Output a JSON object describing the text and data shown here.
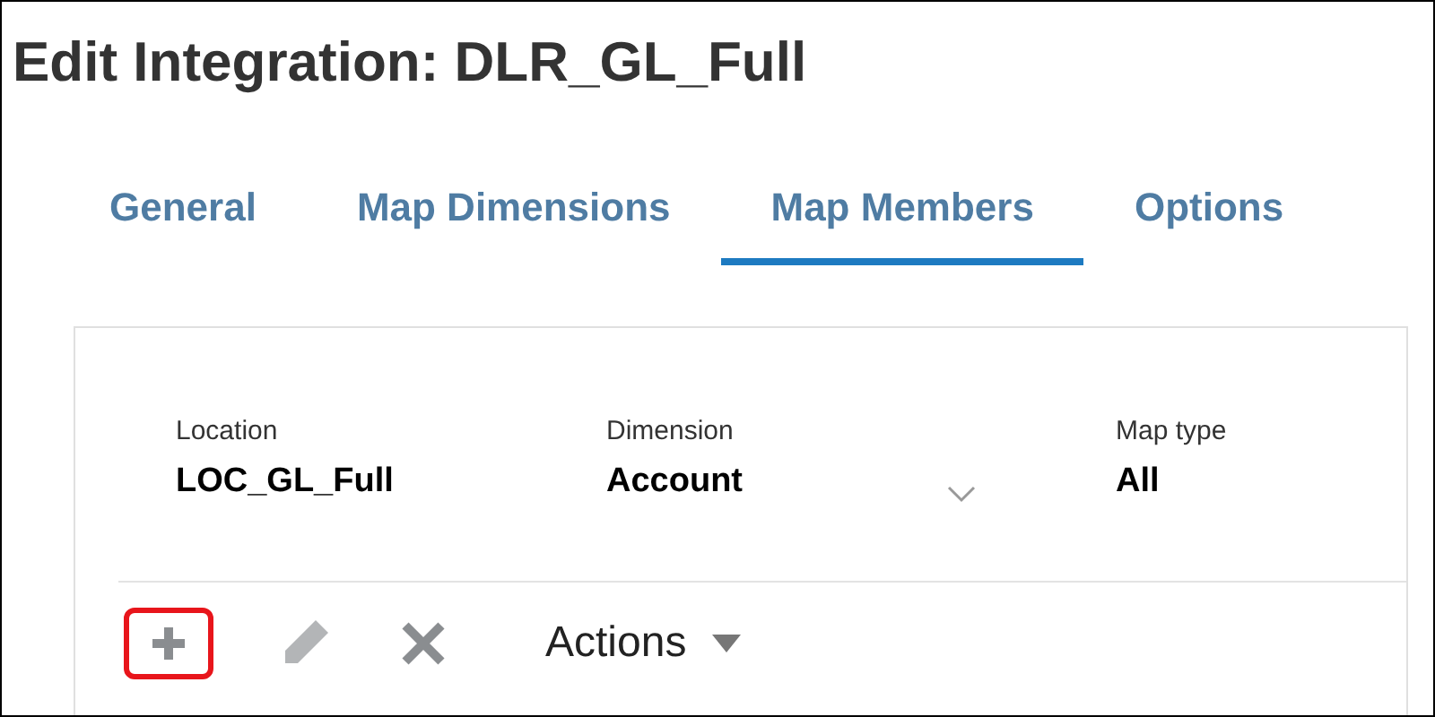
{
  "title": "Edit Integration: DLR_GL_Full",
  "tabs": [
    {
      "label": "General",
      "selected": false
    },
    {
      "label": "Map Dimensions",
      "selected": false
    },
    {
      "label": "Map Members",
      "selected": true
    },
    {
      "label": "Options",
      "selected": false
    }
  ],
  "filters": [
    {
      "label": "Location",
      "value": "LOC_GL_Full",
      "kind": "text"
    },
    {
      "label": "Dimension",
      "value": "Account",
      "kind": "select"
    },
    {
      "label": "Map type",
      "value": "All",
      "kind": "text"
    }
  ],
  "toolbar": {
    "add_highlighted": true,
    "actions_label": "Actions"
  }
}
